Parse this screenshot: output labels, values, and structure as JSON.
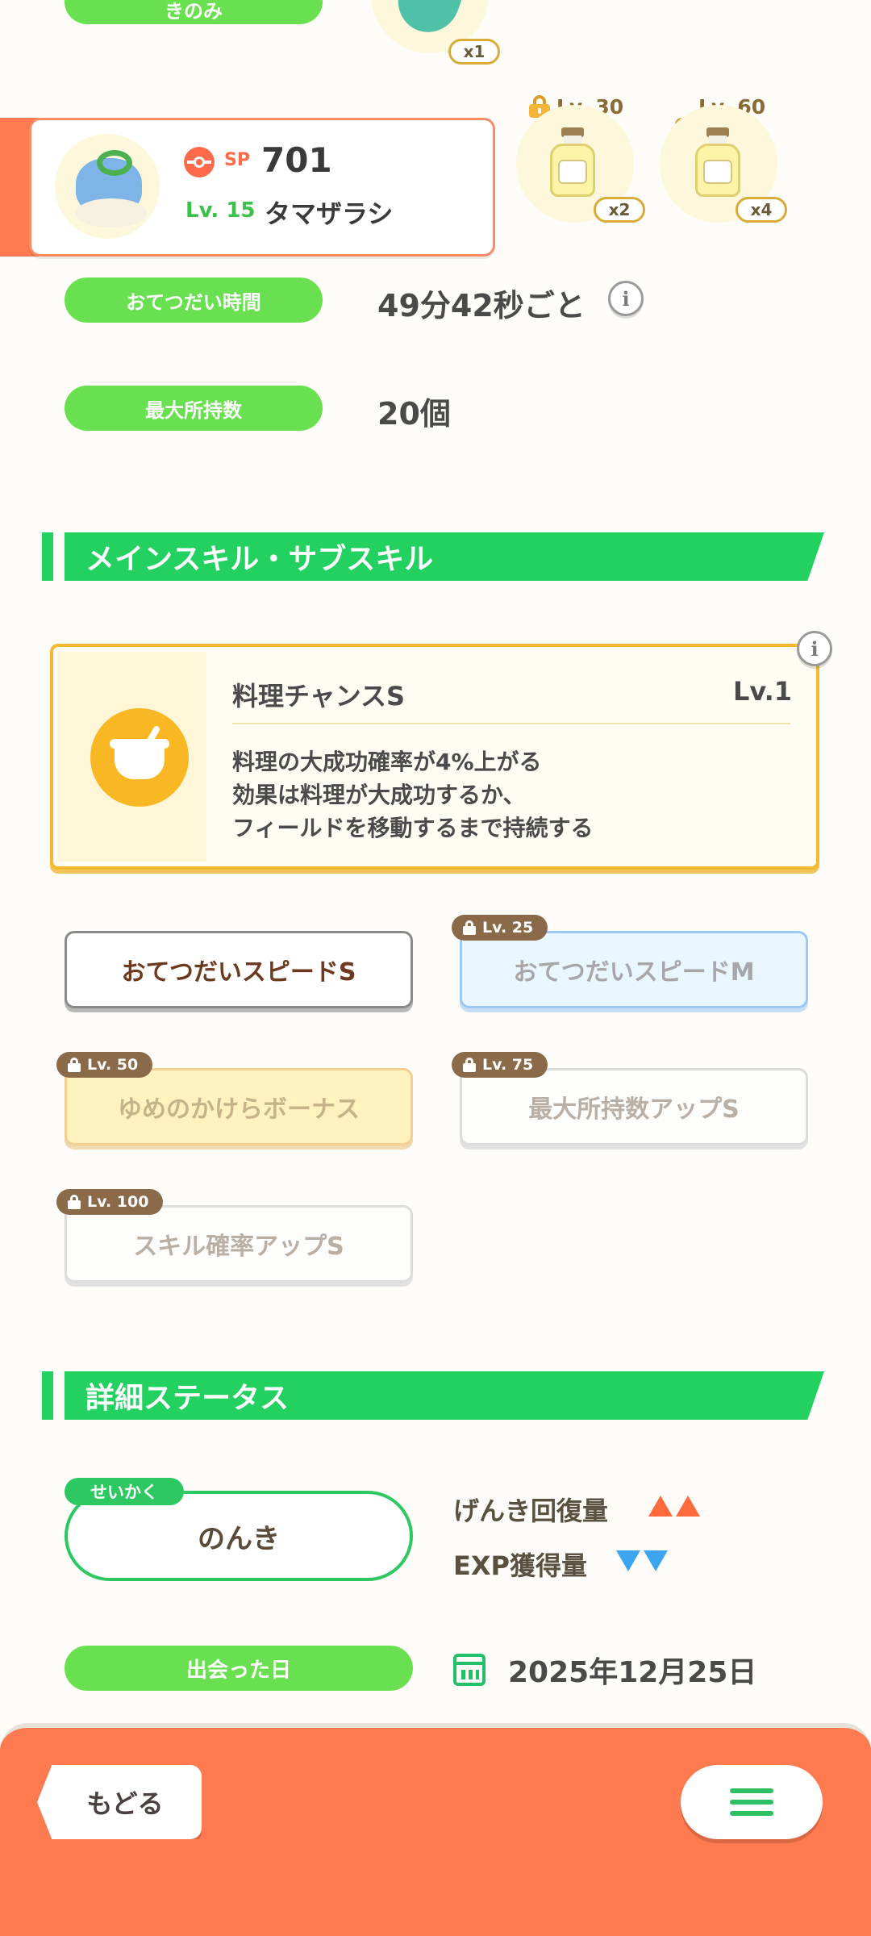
{
  "top_fragment": {
    "pill_label": "きのみ",
    "berry_count": "x1",
    "ingredients": [
      {
        "lock_label": "Lv. 30",
        "count": "x2"
      },
      {
        "lock_label": "Lv. 60",
        "count": "x4"
      }
    ]
  },
  "pokemon": {
    "sp_label": "SP",
    "sp_value": "701",
    "level": "Lv. 15",
    "name": "タマザラシ"
  },
  "stats": {
    "help_time_label": "おてつだい時間",
    "help_time_value": "49分42秒ごと",
    "max_carry_label": "最大所持数",
    "max_carry_value": "20個"
  },
  "skills_section": {
    "title": "メインスキル・サブスキル",
    "main_skill": {
      "name": "料理チャンスS",
      "level": "Lv.1",
      "description": [
        "料理の大成功確率が4%上がる",
        "効果は料理が大成功するか、",
        "フィールドを移動するまで持続する"
      ]
    },
    "sub_skills": [
      {
        "label": "おてつだいスピードS",
        "lock": ""
      },
      {
        "label": "おてつだいスピードM",
        "lock": "Lv. 25"
      },
      {
        "label": "ゆめのかけらボーナス",
        "lock": "Lv. 50"
      },
      {
        "label": "最大所持数アップS",
        "lock": "Lv. 75"
      },
      {
        "label": "スキル確率アップS",
        "lock": "Lv. 100"
      }
    ]
  },
  "detail_section": {
    "title": "詳細ステータス",
    "nature_tag": "せいかく",
    "nature_value": "のんき",
    "up_stat": "げんき回復量",
    "down_stat": "EXP獲得量",
    "met_label": "出会った日",
    "met_date": "2025年12月25日"
  },
  "bottom_bar": {
    "back_label": "もどる"
  },
  "colors": {
    "accent_green": "#22d160",
    "pill_green": "#69e04f",
    "orange": "#ff7a4e",
    "gold": "#f5b82e"
  },
  "icons": [
    "info-icon",
    "lock-icon",
    "calendar-icon",
    "menu-icon",
    "sp-icon",
    "cooking-pot-icon"
  ]
}
